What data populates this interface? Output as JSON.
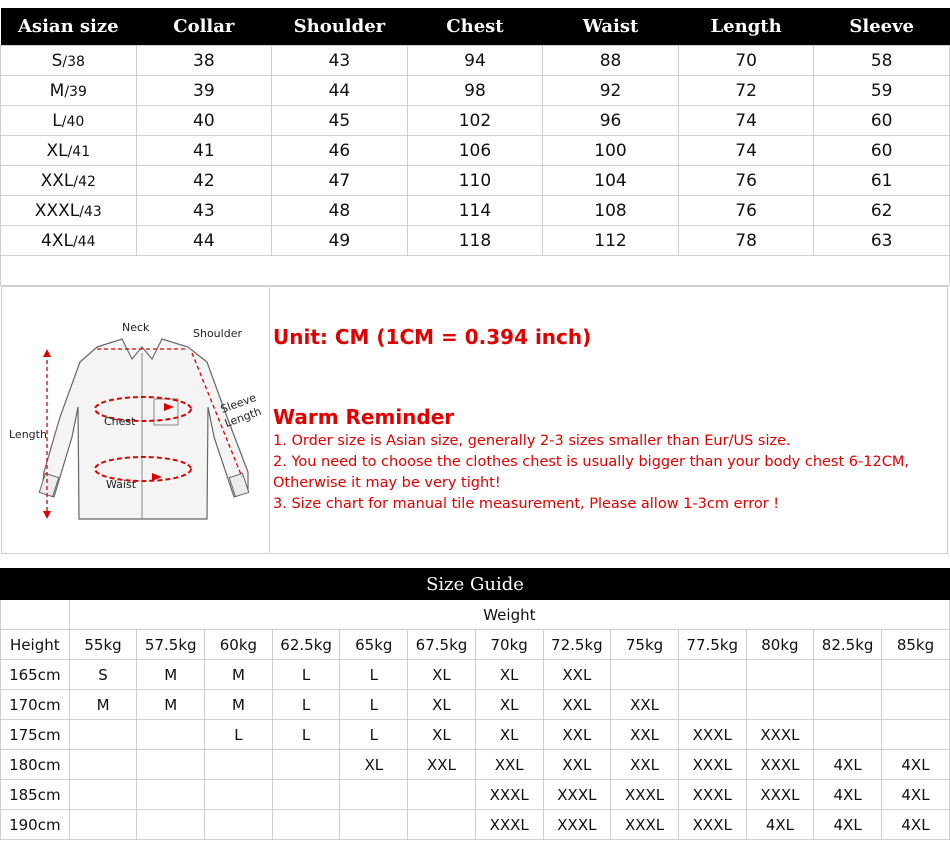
{
  "size_table": {
    "headers": [
      "Asian size",
      "Collar",
      "Shoulder",
      "Chest",
      "Waist",
      "Length",
      "Sleeve"
    ],
    "rows": [
      {
        "size": "S",
        "eu": "/38",
        "values": [
          "38",
          "43",
          "94",
          "88",
          "70",
          "58"
        ]
      },
      {
        "size": "M",
        "eu": "/39",
        "values": [
          "39",
          "44",
          "98",
          "92",
          "72",
          "59"
        ]
      },
      {
        "size": "L",
        "eu": "/40",
        "values": [
          "40",
          "45",
          "102",
          "96",
          "74",
          "60"
        ]
      },
      {
        "size": "XL",
        "eu": "/41",
        "values": [
          "41",
          "46",
          "106",
          "100",
          "74",
          "60"
        ]
      },
      {
        "size": "XXL",
        "eu": "/42",
        "values": [
          "42",
          "47",
          "110",
          "104",
          "76",
          "61"
        ]
      },
      {
        "size": "XXXL",
        "eu": "/43",
        "values": [
          "43",
          "48",
          "114",
          "108",
          "76",
          "62"
        ]
      },
      {
        "size": "4XL",
        "eu": "/44",
        "values": [
          "44",
          "49",
          "118",
          "112",
          "78",
          "63"
        ]
      }
    ]
  },
  "diagram": {
    "labels": {
      "neck": "Neck",
      "shoulder": "Shoulder",
      "sleeve": "Sleeve",
      "sleeve_length": "Length",
      "length": "Length",
      "chest": "Chest",
      "waist": "Waist"
    }
  },
  "notes": {
    "unit": "Unit: CM (1CM = 0.394 inch)",
    "reminder_title": "Warm Reminder",
    "lines": [
      "1. Order size is Asian size, generally 2-3 sizes smaller than Eur/US size.",
      "2. You need to choose the clothes chest is usually bigger than your body chest 6-12CM,",
      "Otherwise it may be very tight!",
      "3. Size chart for manual tile measurement, Please allow 1-3cm error !"
    ]
  },
  "size_guide": {
    "title": "Size Guide",
    "weight_label": "Weight",
    "height_label": "Height",
    "weights": [
      "55kg",
      "57.5kg",
      "60kg",
      "62.5kg",
      "65kg",
      "67.5kg",
      "70kg",
      "72.5kg",
      "75kg",
      "77.5kg",
      "80kg",
      "82.5kg",
      "85kg"
    ],
    "rows": [
      {
        "height": "165cm",
        "cells": [
          "S",
          "M",
          "M",
          "L",
          "L",
          "XL",
          "XL",
          "XXL",
          "",
          "",
          "",
          "",
          ""
        ]
      },
      {
        "height": "170cm",
        "cells": [
          "M",
          "M",
          "M",
          "L",
          "L",
          "XL",
          "XL",
          "XXL",
          "XXL",
          "",
          "",
          "",
          ""
        ]
      },
      {
        "height": "175cm",
        "cells": [
          "",
          "",
          "L",
          "L",
          "L",
          "XL",
          "XL",
          "XXL",
          "XXL",
          "XXXL",
          "XXXL",
          "",
          ""
        ]
      },
      {
        "height": "180cm",
        "cells": [
          "",
          "",
          "",
          "",
          "XL",
          "XXL",
          "XXL",
          "XXL",
          "XXL",
          "XXXL",
          "XXXL",
          "4XL",
          "4XL"
        ]
      },
      {
        "height": "185cm",
        "cells": [
          "",
          "",
          "",
          "",
          "",
          "",
          "XXXL",
          "XXXL",
          "XXXL",
          "XXXL",
          "XXXL",
          "4XL",
          "4XL"
        ]
      },
      {
        "height": "190cm",
        "cells": [
          "",
          "",
          "",
          "",
          "",
          "",
          "XXXL",
          "XXXL",
          "XXXL",
          "XXXL",
          "4XL",
          "4XL",
          "4XL"
        ]
      }
    ]
  },
  "colors": {
    "header_bg": "#000000",
    "accent_red": "#e00000",
    "grid": "#cfcfcf"
  }
}
